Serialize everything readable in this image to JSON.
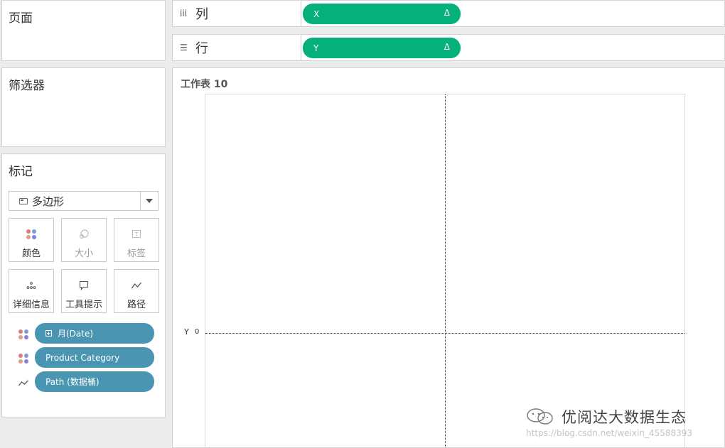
{
  "left_panels": {
    "pages": {
      "title": "页面"
    },
    "filters": {
      "title": "筛选器"
    },
    "marks": {
      "title": "标记",
      "mark_type": {
        "label": "多边形",
        "icon": "polygon-mark-icon"
      },
      "buttons": [
        {
          "label": "颜色",
          "icon": "color-dots-icon",
          "enabled": true
        },
        {
          "label": "大小",
          "icon": "size-icon",
          "enabled": false
        },
        {
          "label": "标签",
          "icon": "label-icon",
          "enabled": false
        },
        {
          "label": "详细信息",
          "icon": "detail-icon",
          "enabled": true
        },
        {
          "label": "工具提示",
          "icon": "tooltip-icon",
          "enabled": true
        },
        {
          "label": "路径",
          "icon": "path-icon",
          "enabled": true
        }
      ],
      "fields": [
        {
          "label": "月(Date)",
          "icon": "color-dots-icon"
        },
        {
          "label": "Product Category",
          "icon": "color-dots-icon"
        },
        {
          "label": "Path (数据桶)",
          "icon": "path-icon"
        }
      ]
    }
  },
  "shelves": {
    "columns": {
      "icon": "iii",
      "label": "列",
      "pill": {
        "label": "X",
        "suffix": "Δ"
      }
    },
    "rows": {
      "icon": "☰",
      "label": "行",
      "pill": {
        "label": "Y",
        "suffix": "Δ"
      }
    }
  },
  "worksheet": {
    "title": "工作表 10",
    "y_axis_label": "Y",
    "y_tick": "0"
  },
  "watermark": {
    "title": "优阅达大数据生态",
    "url": "https://blog.csdn.net/weixin_45588393"
  },
  "colors": {
    "measure_pill": "#06b07a",
    "dimension_pill": "#4a96b2",
    "panel_bg": "#ffffff",
    "app_bg": "#ececec"
  }
}
